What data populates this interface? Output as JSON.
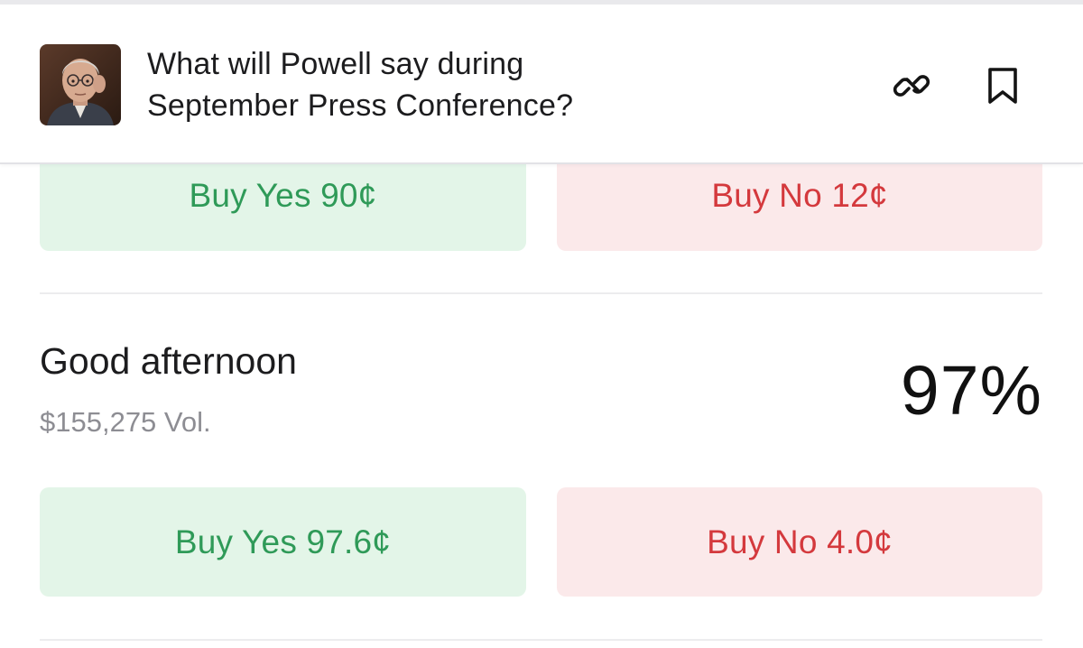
{
  "header": {
    "title_line1": "What will Powell say during",
    "title_line2": "September Press Conference?",
    "avatar_icon": "person-portrait",
    "link_icon": "link-icon",
    "bookmark_icon": "bookmark-icon"
  },
  "previous_market": {
    "buy_yes_label": "Buy Yes 90¢",
    "buy_no_label": "Buy No 12¢"
  },
  "market": {
    "label": "Good afternoon",
    "volume": "$155,275 Vol.",
    "percent": "97%",
    "buy_yes_label": "Buy Yes 97.6¢",
    "buy_no_label": "Buy No 4.0¢"
  },
  "colors": {
    "yes_text": "#2f9a58",
    "yes_bg": "#e3f5e8",
    "no_text": "#d4393d",
    "no_bg": "#fbe9ea"
  }
}
